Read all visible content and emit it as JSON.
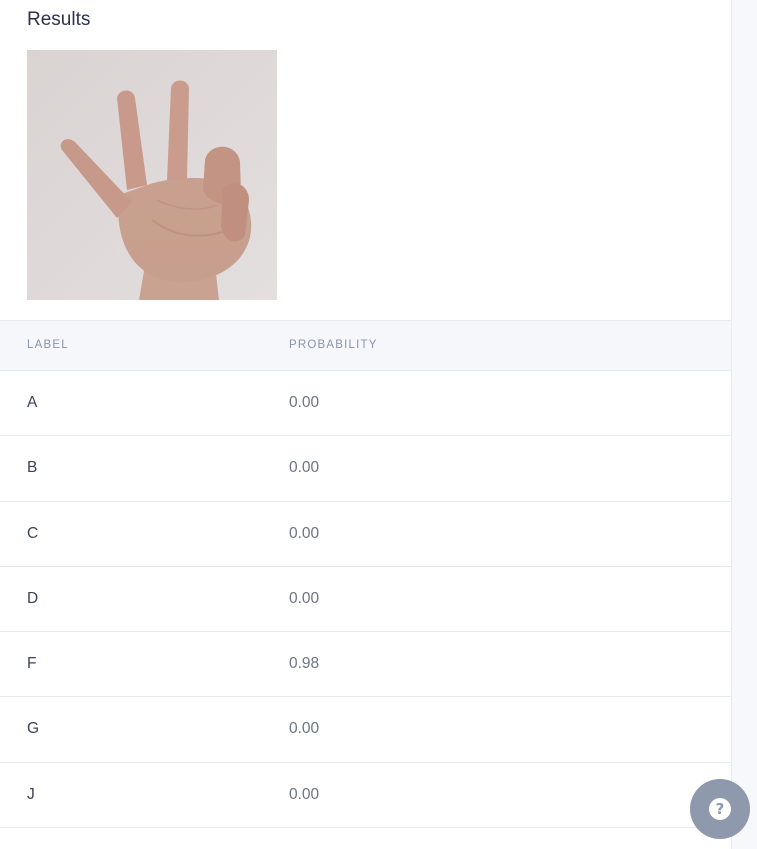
{
  "results": {
    "title": "Results",
    "image": {
      "alt": "hand-sign-photo"
    }
  },
  "table": {
    "headers": {
      "label": "LABEL",
      "probability": "PROBABILITY"
    },
    "rows": [
      {
        "label": "A",
        "probability": "0.00"
      },
      {
        "label": "B",
        "probability": "0.00"
      },
      {
        "label": "C",
        "probability": "0.00"
      },
      {
        "label": "D",
        "probability": "0.00"
      },
      {
        "label": "F",
        "probability": "0.98"
      },
      {
        "label": "G",
        "probability": "0.00"
      },
      {
        "label": "J",
        "probability": "0.00"
      }
    ]
  },
  "help": {
    "icon": "question-circle-icon",
    "glyph": "?"
  },
  "colors": {
    "title": "#2b3350",
    "header_bg": "#f5f7fb",
    "help_button": "#8e99ad"
  }
}
